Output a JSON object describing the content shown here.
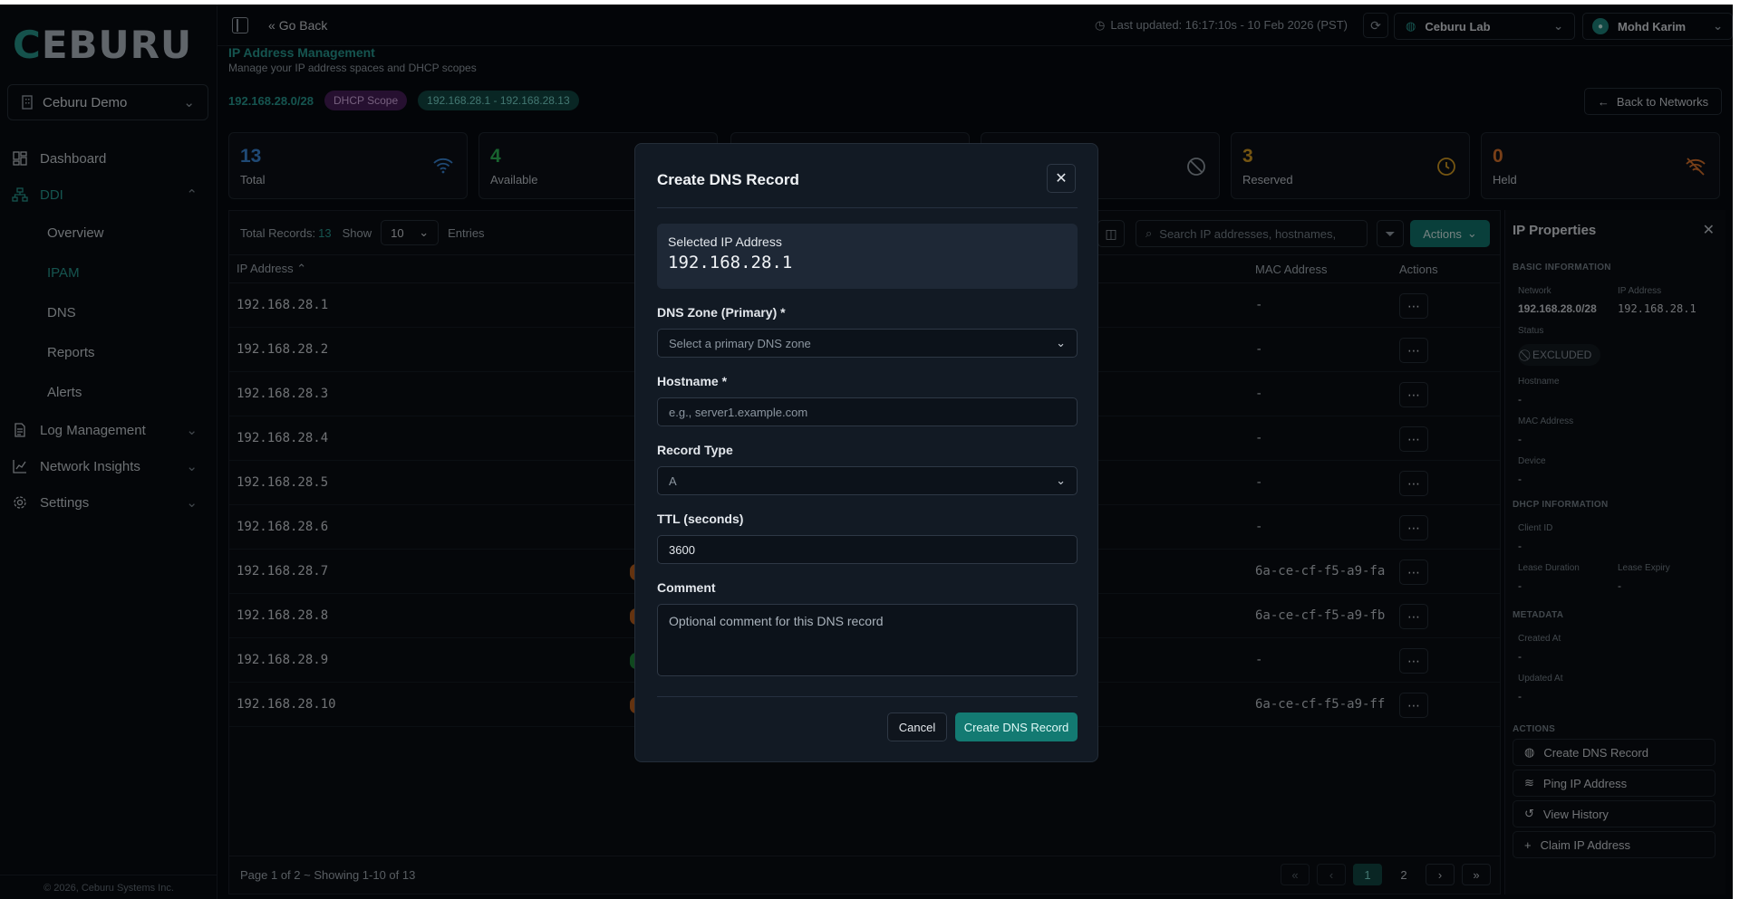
{
  "brand": {
    "logo_c": "C",
    "logo_rest": "EBURU"
  },
  "sidebar": {
    "org": "Ceburu Demo",
    "items": [
      {
        "label": "Dashboard"
      },
      {
        "label": "DDI"
      },
      {
        "label": "Log Management"
      },
      {
        "label": "Network Insights"
      },
      {
        "label": "Settings"
      }
    ],
    "ddi_sub": [
      "Overview",
      "IPAM",
      "DNS",
      "Reports",
      "Alerts"
    ],
    "footer": "© 2026, Ceburu Systems Inc."
  },
  "header": {
    "go_back": "Go Back",
    "last_updated": "Last updated: 16:17:10s - 10 Feb 2026 (PST)",
    "lab": "Ceburu Lab",
    "user": "Mohd Karim"
  },
  "page": {
    "title": "IP Address Management",
    "subtitle": "Manage your IP address spaces and DHCP scopes",
    "network": "192.168.28.0/28",
    "badge_scope": "DHCP Scope",
    "badge_range": "192.168.28.1 - 192.168.28.13",
    "back_networks": "Back to Networks"
  },
  "stats": [
    {
      "value": "13",
      "label": "Total",
      "color": "#3d8de0"
    },
    {
      "value": "4",
      "label": "Available",
      "color": "#2fbf5a"
    },
    {
      "value": "3",
      "label": "Reserved",
      "color": "#e0a423"
    },
    {
      "value": "0",
      "label": "Held",
      "color": "#e67a2e"
    }
  ],
  "table": {
    "total_label": "Total Records:",
    "total_count": "13",
    "show_label": "Show",
    "entries_value": "10",
    "entries_label": "Entries",
    "search_placeholder": "Search IP addresses, hostnames,",
    "actions_label": "Actions",
    "headers": {
      "ip": "IP Address",
      "mac": "MAC Address",
      "actions": "Actions"
    },
    "rows": [
      {
        "ip": "192.168.28.1",
        "mac": "-"
      },
      {
        "ip": "192.168.28.2",
        "mac": "-"
      },
      {
        "ip": "192.168.28.3",
        "mac": "-"
      },
      {
        "ip": "192.168.28.4",
        "mac": "-"
      },
      {
        "ip": "192.168.28.5",
        "mac": "-"
      },
      {
        "ip": "192.168.28.6",
        "mac": "-"
      },
      {
        "ip": "192.168.28.7",
        "mac": "6a-ce-cf-f5-a9-fa"
      },
      {
        "ip": "192.168.28.8",
        "mac": "6a-ce-cf-f5-a9-fb"
      },
      {
        "ip": "192.168.28.9",
        "mac": "-"
      },
      {
        "ip": "192.168.28.10",
        "mac": "6a-ce-cf-f5-a9-ff"
      }
    ],
    "footer": "Page 1 of 2 ~ Showing 1-10 of 13",
    "pages": [
      "1",
      "2"
    ]
  },
  "props": {
    "title": "IP Properties",
    "basic": "BASIC INFORMATION",
    "network_label": "Network",
    "network_value": "192.168.28.0/28",
    "ip_label": "IP Address",
    "ip_value": "192.168.28.1",
    "status_label": "Status",
    "status_value": "EXCLUDED",
    "hostname_label": "Hostname",
    "hostname_value": "-",
    "mac_label": "MAC Address",
    "mac_value": "-",
    "device_label": "Device",
    "device_value": "-",
    "dhcp": "DHCP INFORMATION",
    "client_label": "Client ID",
    "client_value": "-",
    "lease_dur_label": "Lease Duration",
    "lease_dur_value": "-",
    "lease_exp_label": "Lease Expiry",
    "lease_exp_value": "-",
    "metadata": "METADATA",
    "created_label": "Created At",
    "created_value": "-",
    "updated_label": "Updated At",
    "updated_value": "-",
    "actions": "ACTIONS",
    "act_dns": "Create DNS Record",
    "act_ping": "Ping IP Address",
    "act_history": "View History",
    "act_claim": "Claim IP Address"
  },
  "modal": {
    "title": "Create DNS Record",
    "selected_label": "Selected IP Address",
    "selected_ip": "192.168.28.1",
    "zone_label": "DNS Zone (Primary) *",
    "zone_placeholder": "Select a primary DNS zone",
    "hostname_label": "Hostname *",
    "hostname_placeholder": "e.g., server1.example.com",
    "type_label": "Record Type",
    "type_value": "A",
    "ttl_label": "TTL (seconds)",
    "ttl_value": "3600",
    "comment_label": "Comment",
    "comment_placeholder": "Optional comment for this DNS record",
    "cancel": "Cancel",
    "submit": "Create DNS Record"
  }
}
